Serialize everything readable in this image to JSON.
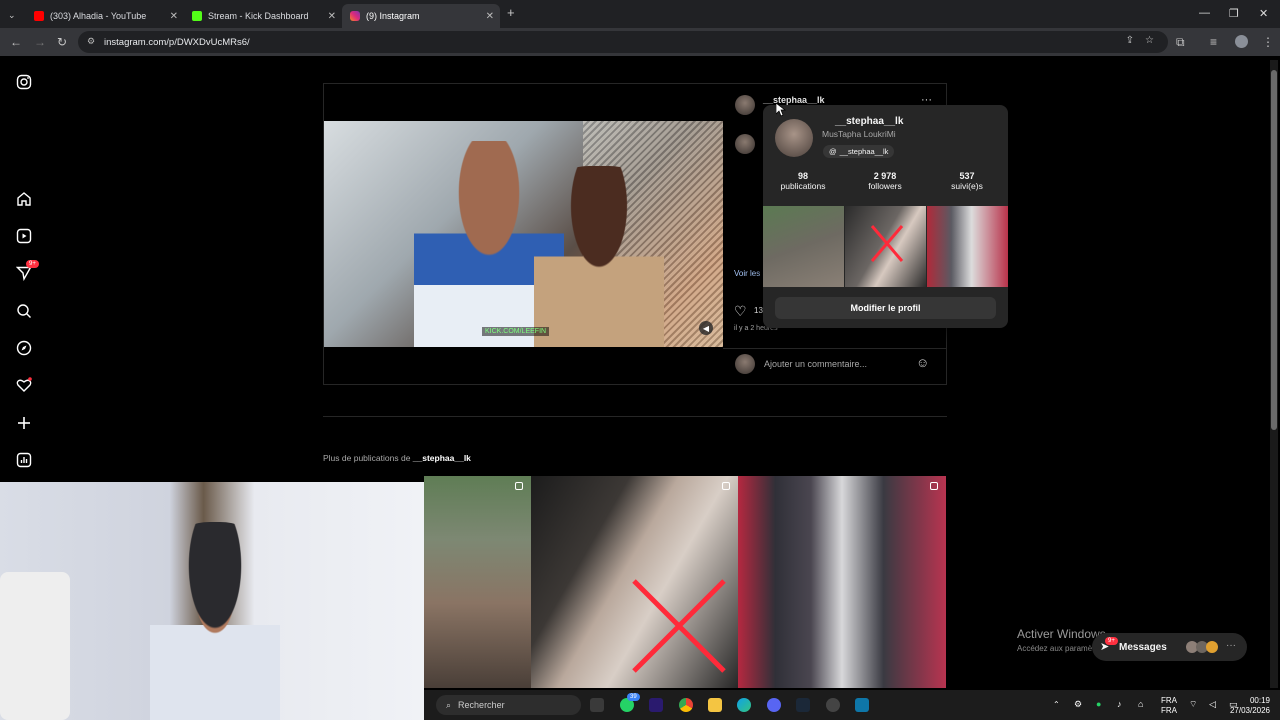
{
  "browser": {
    "tabs": [
      {
        "title": "(303) Alhadia - YouTube",
        "favicon_color": "#ff0000",
        "active": false
      },
      {
        "title": "Stream - Kick Dashboard",
        "favicon_color": "#53fc18",
        "active": false
      },
      {
        "title": "(9) Instagram",
        "favicon_color": "#e1306c",
        "active": true
      }
    ],
    "new_tab_label": "+",
    "url": "instagram.com/p/DWXDvUcMRs6/"
  },
  "nav": {
    "notification_badge": "9+",
    "items": [
      "instagram-logo",
      "home",
      "reels",
      "messages",
      "search",
      "explore",
      "notifications",
      "create",
      "dashboard"
    ]
  },
  "post": {
    "username": "__stephaa__lk",
    "video_caption": "KICK.COM/LEEFIN",
    "see_translation_partial": "Voir les",
    "likes_partial": "13",
    "time_ago_partial": "il y a 2 heures",
    "comment_placeholder": "Ajouter un commentaire..."
  },
  "hovercard": {
    "username": "__stephaa__lk",
    "full_name": "MusTapha LoukriMi",
    "threads_handle": "__stephaa__lk",
    "stats": [
      {
        "value": "98",
        "label": "publications"
      },
      {
        "value": "2 978",
        "label": "followers"
      },
      {
        "value": "537",
        "label": "suivi(e)s"
      }
    ],
    "button_label": "Modifier le profil"
  },
  "more_posts": {
    "prefix": "Plus de publications de ",
    "username": "__stephaa__lk"
  },
  "windows_activation": {
    "title": "Activer Windows",
    "subtitle": "Accédez aux paramètres"
  },
  "messages_bar": {
    "label": "Messages",
    "badge": "9+"
  },
  "taskbar": {
    "search_placeholder": "Rechercher",
    "lang_top": "FRA",
    "lang_bottom": "FRA",
    "time": "00:19",
    "date": "27/03/2026",
    "chat_badge": "39"
  }
}
